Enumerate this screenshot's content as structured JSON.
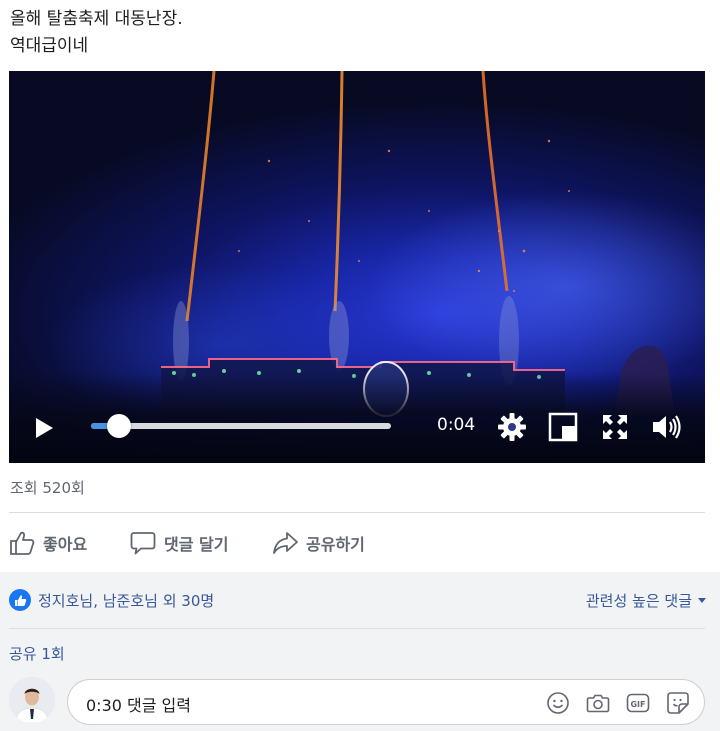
{
  "post": {
    "lines": [
      "올해 탈춤축제 대동난장.",
      "역대급이네"
    ]
  },
  "video": {
    "current_time": "0:04",
    "progress": 0.0
  },
  "stats": {
    "views": "조회 520회"
  },
  "actions": {
    "like": "좋아요",
    "comment": "댓글 달기",
    "share": "공유하기"
  },
  "reactions": {
    "text": "정지호님, 남준호님 외 30명",
    "sort_label": "관련성 높은 댓글"
  },
  "shares": {
    "text": "공유 1회"
  },
  "comment_input": {
    "placeholder": "0:30 댓글 입력",
    "icons": [
      "emoji-icon",
      "camera-icon",
      "gif-icon",
      "sticker-icon"
    ]
  },
  "colors": {
    "link": "#385898",
    "like_blue": "#1877f2",
    "progress_blue": "#4a90e2",
    "gray_bg": "#f2f3f5"
  }
}
